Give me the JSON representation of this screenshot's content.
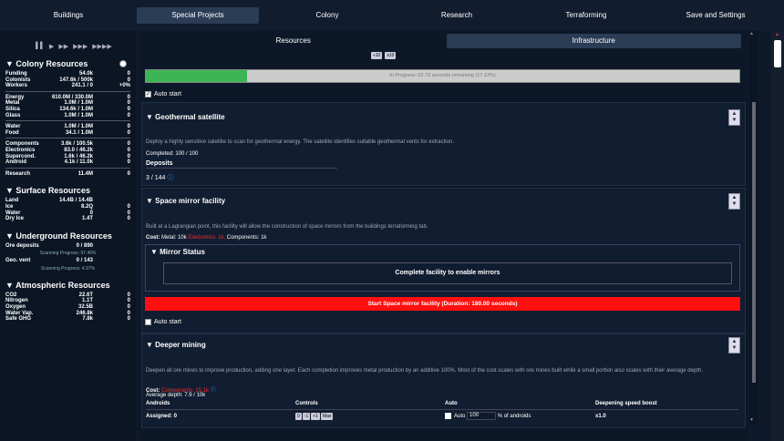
{
  "topnav": [
    "Buildings",
    "Special Projects",
    "Colony",
    "Research",
    "Terraforming",
    "Save and Settings"
  ],
  "speed_controls": [
    "▌▌",
    "▶",
    "▶▶",
    "▶▶▶",
    "▶▶▶▶"
  ],
  "sidebar": {
    "colony_title": "▼ Colony Resources",
    "colony": [
      {
        "n": "Funding",
        "v": "54.0k",
        "r": "0"
      },
      {
        "n": "Colonists",
        "v": "147.6k / 500k",
        "r": "0"
      },
      {
        "n": "Workers",
        "v": "241.1 / 0",
        "r": "+0%"
      },
      {
        "gap": true
      },
      {
        "n": "Energy",
        "v": "610.0M / 330.0M",
        "r": "0"
      },
      {
        "n": "Metal",
        "v": "1.0M / 1.0M",
        "r": "0"
      },
      {
        "n": "Silica",
        "v": "134.6k / 1.0M",
        "r": "0"
      },
      {
        "n": "Glass",
        "v": "1.0M / 1.0M",
        "r": "0"
      },
      {
        "gap": true
      },
      {
        "n": "Water",
        "v": "1.0M / 1.0M",
        "r": "0"
      },
      {
        "n": "Food",
        "v": "34.1 / 1.0M",
        "r": "0"
      },
      {
        "gap": true
      },
      {
        "n": "Components",
        "v": "3.6k / 100.5k",
        "r": "0"
      },
      {
        "n": "Electronics",
        "v": "83.0 / 46.2k",
        "r": "0"
      },
      {
        "n": "Supercond.",
        "v": "1.6k / 46.2k",
        "r": "0"
      },
      {
        "n": "Android",
        "v": "4.1k / 11.0k",
        "r": "0"
      },
      {
        "gap": true
      },
      {
        "n": "Research",
        "v": "11.4M",
        "r": "0"
      }
    ],
    "surface_title": "▼ Surface Resources",
    "surface": [
      {
        "n": "Land",
        "v": "14.4B / 14.4B",
        "r": ""
      },
      {
        "n": "Ice",
        "v": "8.2Q",
        "r": "0"
      },
      {
        "n": "Water",
        "v": "0",
        "r": "0"
      },
      {
        "n": "Dry Ice",
        "v": "1.4T",
        "r": "0"
      }
    ],
    "under_title": "▼ Underground Resources",
    "ore_label": "Ore deposits",
    "ore_value": "0 / 890",
    "ore_scan": "Scanning Progress: 97.46%",
    "geo_label": "Geo. vent",
    "geo_value": "0 / 143",
    "geo_scan": "Scanning Progress: 4.97%",
    "atmo_title": "▼ Atmospheric Resources",
    "atmo": [
      {
        "n": "CO2",
        "v": "22.6T",
        "r": "0"
      },
      {
        "n": "Nitrogen",
        "v": "1.1T",
        "r": "0"
      },
      {
        "n": "Oxygen",
        "v": "32.5B",
        "r": "0"
      },
      {
        "n": "Water Vap.",
        "v": "246.8k",
        "r": "0"
      },
      {
        "n": "Safe GHG",
        "v": "7.8k",
        "r": "0"
      }
    ]
  },
  "subtabs": [
    "Resources",
    "Infrastructure"
  ],
  "top_ctrl": [
    "÷10",
    "x10"
  ],
  "progress": {
    "text": "In Progress: 62.72 seconds remaining (17.12%)",
    "fraction": 0.1712
  },
  "auto_start": "Auto start",
  "geo": {
    "title": "▼ Geothermal satellite",
    "desc": "Deploy a highly sensitive satellite to scan for geothermal energy. The satellite identifies suitable geothermal vents for extraction.",
    "completed": "Completed: 100 / 100",
    "deposits_label": "Deposits",
    "deposits_value": "3 / 144"
  },
  "mirror": {
    "title": "▼ Space mirror facility",
    "desc": "Built at a Lagrangian point, this facility will allow the construction of space mirrors from the buildings terraforming tab.",
    "cost_label": "Cost:",
    "cost_metal": "Metal: 10k",
    "cost_electronics": "Electronics: 1k,",
    "cost_components": "Components: 1k",
    "status_title": "▼ Mirror Status",
    "status_msg": "Complete facility to enable mirrors",
    "start_btn": "Start Space mirror facility (Duration: 180.00 seconds)"
  },
  "deeper": {
    "title": "▼ Deeper mining",
    "desc": "Deepen all ore mines to improve production, adding one layer. Each completion improves metal production by an additive 100%. Most of the cost scales with ore mines built while a small portion also scales with their average depth.",
    "cost_label": "Cost:",
    "cost_components": "Components: 15.1k",
    "avg_depth": "Average depth: 7.9 / 10k",
    "headers": [
      "Androids",
      "Controls",
      "Auto",
      "Deepening speed boost"
    ],
    "assigned": "Assigned: 0",
    "ctl_btns": [
      "0",
      "-1",
      "+1",
      "Max"
    ],
    "auto_label": "Auto",
    "auto_value": "100",
    "auto_suffix": "% of androids",
    "boost": "x1.0"
  }
}
